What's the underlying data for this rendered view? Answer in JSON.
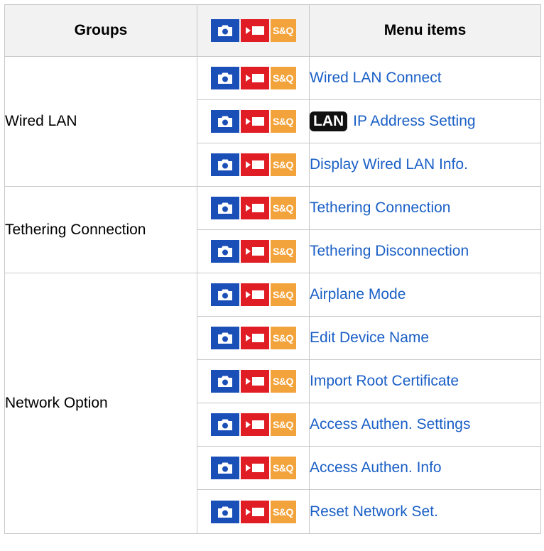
{
  "header": {
    "groups": "Groups",
    "menu_items": "Menu items",
    "mode_icons": [
      "camera-still",
      "camera-movie",
      "S&Q"
    ]
  },
  "colors": {
    "still": "#1b4fb8",
    "movie": "#e01c24",
    "sq": "#f3a33b",
    "link": "#1a5fc6"
  },
  "sq_label": "S&Q",
  "groups": [
    {
      "name": "Wired LAN",
      "items": [
        {
          "label": "Wired LAN Connect"
        },
        {
          "badge": "LAN",
          "label": "IP Address Setting"
        },
        {
          "label": "Display Wired LAN Info."
        }
      ]
    },
    {
      "name": "Tethering Connection",
      "items": [
        {
          "label": "Tethering Connection"
        },
        {
          "label": "Tethering Disconnection"
        }
      ]
    },
    {
      "name": "Network Option",
      "items": [
        {
          "label": "Airplane Mode"
        },
        {
          "label": "Edit Device Name"
        },
        {
          "label": "Import Root Certificate"
        },
        {
          "label": "Access Authen. Settings"
        },
        {
          "label": "Access Authen. Info"
        },
        {
          "label": "Reset Network Set."
        }
      ]
    }
  ]
}
